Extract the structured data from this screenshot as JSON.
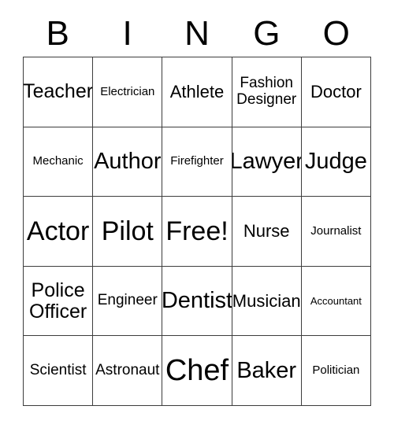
{
  "card": {
    "header": {
      "letters": [
        "B",
        "I",
        "N",
        "G",
        "O"
      ]
    },
    "cells": [
      {
        "label": "Teacher",
        "size": "sz-l"
      },
      {
        "label": "Electrician",
        "size": "sz-s"
      },
      {
        "label": "Athlete",
        "size": "sz-ml"
      },
      {
        "label": "Fashion\nDesigner",
        "size": "sz-m"
      },
      {
        "label": "Doctor",
        "size": "sz-ml"
      },
      {
        "label": "Mechanic",
        "size": "sz-s"
      },
      {
        "label": "Author",
        "size": "sz-xl"
      },
      {
        "label": "Firefighter",
        "size": "sz-s"
      },
      {
        "label": "Lawyer",
        "size": "sz-xl"
      },
      {
        "label": "Judge",
        "size": "sz-xl"
      },
      {
        "label": "Actor",
        "size": "sz-xxl"
      },
      {
        "label": "Pilot",
        "size": "sz-xxl"
      },
      {
        "label": "Free!",
        "size": "sz-xxl"
      },
      {
        "label": "Nurse",
        "size": "sz-ml"
      },
      {
        "label": "Journalist",
        "size": "sz-s"
      },
      {
        "label": "Police\nOfficer",
        "size": "sz-l"
      },
      {
        "label": "Engineer",
        "size": "sz-m"
      },
      {
        "label": "Dentist",
        "size": "sz-xl"
      },
      {
        "label": "Musician",
        "size": "sz-ml"
      },
      {
        "label": "Accountant",
        "size": "sz-xs"
      },
      {
        "label": "Scientist",
        "size": "sz-m"
      },
      {
        "label": "Astronaut",
        "size": "sz-m"
      },
      {
        "label": "Chef",
        "size": "sz-max"
      },
      {
        "label": "Baker",
        "size": "sz-xl"
      },
      {
        "label": "Politician",
        "size": "sz-s"
      }
    ],
    "colors": {
      "border": "#3d3d3d",
      "text": "#000000",
      "background": "#ffffff"
    }
  }
}
